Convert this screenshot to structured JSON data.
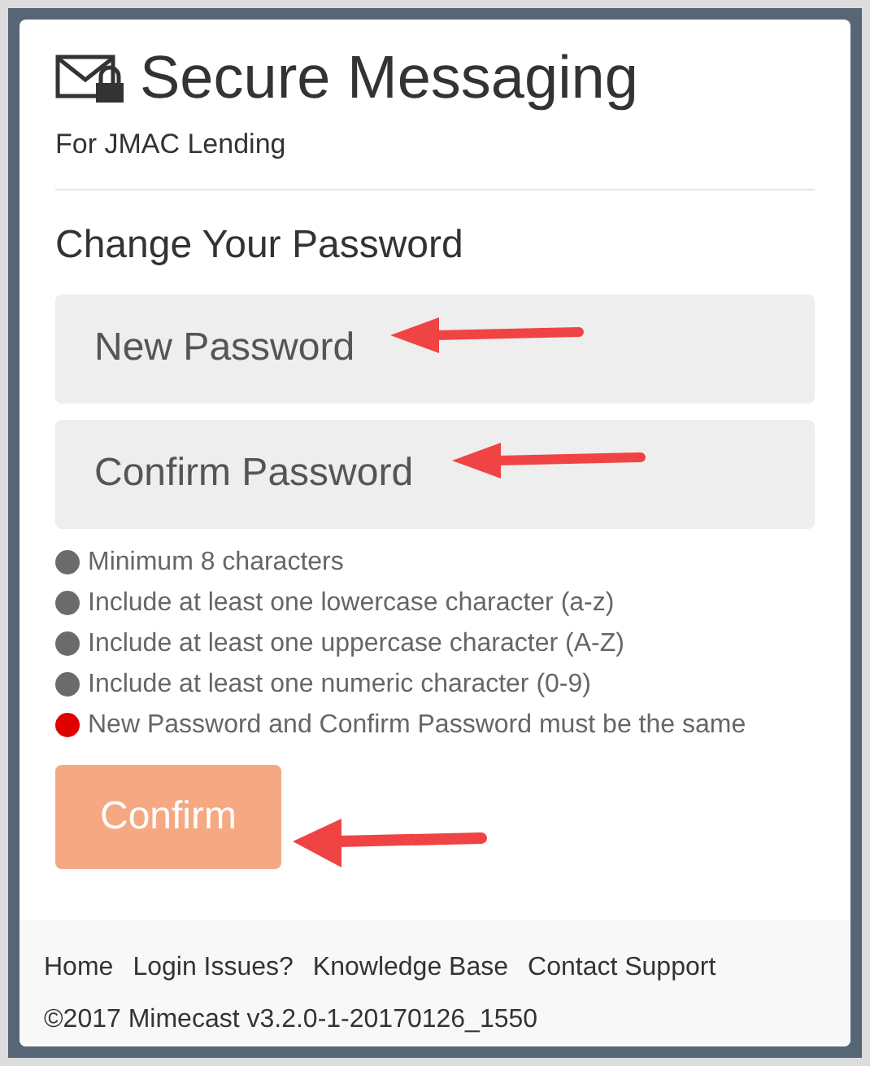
{
  "header": {
    "title": "Secure Messaging",
    "subtitle": "For JMAC Lending"
  },
  "form": {
    "heading": "Change Your Password",
    "fields": [
      {
        "placeholder": "New Password"
      },
      {
        "placeholder": "Confirm Password"
      }
    ],
    "requirements": [
      {
        "text": "Minimum 8 characters",
        "color": "#6b6b6b"
      },
      {
        "text": "Include at least one lowercase character (a-z)",
        "color": "#6b6b6b"
      },
      {
        "text": "Include at least one uppercase character (A-Z)",
        "color": "#6b6b6b"
      },
      {
        "text": "Include at least one numeric character (0-9)",
        "color": "#6b6b6b"
      },
      {
        "text": "New Password and Confirm Password must be the same",
        "color": "#e00000"
      }
    ],
    "submit": {
      "label": "Confirm",
      "disabled": true
    }
  },
  "footer": {
    "links": [
      "Home",
      "Login Issues?",
      "Knowledge Base",
      "Contact Support"
    ],
    "copyright": "©2017 Mimecast v3.2.0-1-20170126_1550"
  }
}
